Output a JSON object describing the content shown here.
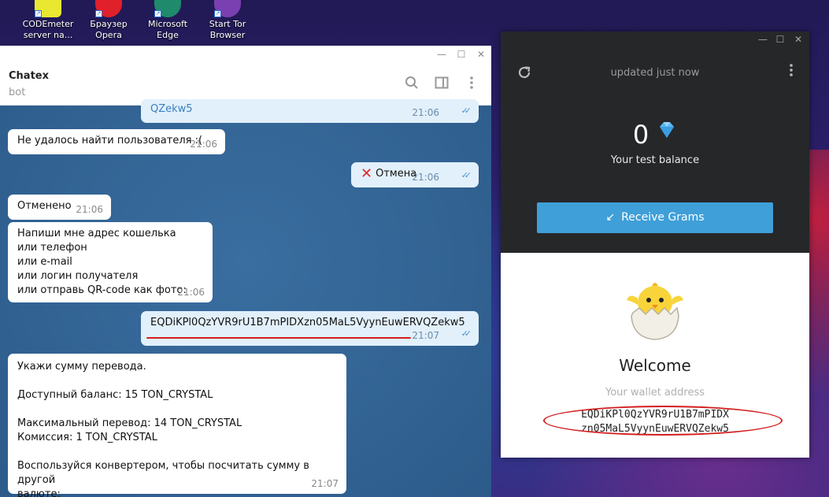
{
  "desktop": {
    "icons": [
      {
        "label_line1": "CODEmeter",
        "label_line2": "server na...",
        "color": "#e8e830"
      },
      {
        "label_line1": "Браузер",
        "label_line2": "Opera",
        "color": "#e0202a"
      },
      {
        "label_line1": "Microsoft",
        "label_line2": "Edge",
        "color": "#1f8a6c"
      },
      {
        "label_line1": "Start Tor",
        "label_line2": "Browser",
        "color": "#7a3fb0"
      }
    ]
  },
  "telegram": {
    "chat_title": "Chatex",
    "chat_subtitle": "bot",
    "messages": [
      {
        "text": "QZekw5",
        "time": "21:06"
      },
      {
        "text": "Не удалось найти пользователя :(",
        "time": "21:06"
      },
      {
        "text": "Отмена",
        "time": "21:06"
      },
      {
        "text": "Отменено",
        "time": "21:06"
      },
      {
        "lines": [
          "Напиши мне адрес кошелька",
          "или телефон",
          "или e-mail",
          "или логин получателя",
          "или отправь QR-code как фото:"
        ],
        "time": "21:06"
      },
      {
        "text": "EQDiKPl0QzYVR9rU1B7mPIDXzn05MaL5VyynEuwERVQZekw5",
        "time": "21:07"
      },
      {
        "lines": [
          "Укажи сумму перевода.",
          "",
          "Доступный баланс: 15 TON_CRYSTAL",
          "",
          "Максимальный перевод: 14 TON_CRYSTAL",
          "Комиссия: 1 TON_CRYSTAL",
          "",
          "Воспользуйся конвертером, чтобы посчитать сумму в другой",
          "валюте:"
        ],
        "time": "21:07"
      }
    ]
  },
  "wallet": {
    "updated": "updated just now",
    "balance": "0",
    "balance_label": "Your test balance",
    "receive_label": "Receive Grams",
    "welcome": "Welcome",
    "address_label": "Your wallet address",
    "address_line1": "EQDiKPl0QzYVR9rU1B7mPIDX",
    "address_line2": "zn05MaL5VyynEuwERVQZekw5",
    "accent": "#3f9fd8"
  }
}
